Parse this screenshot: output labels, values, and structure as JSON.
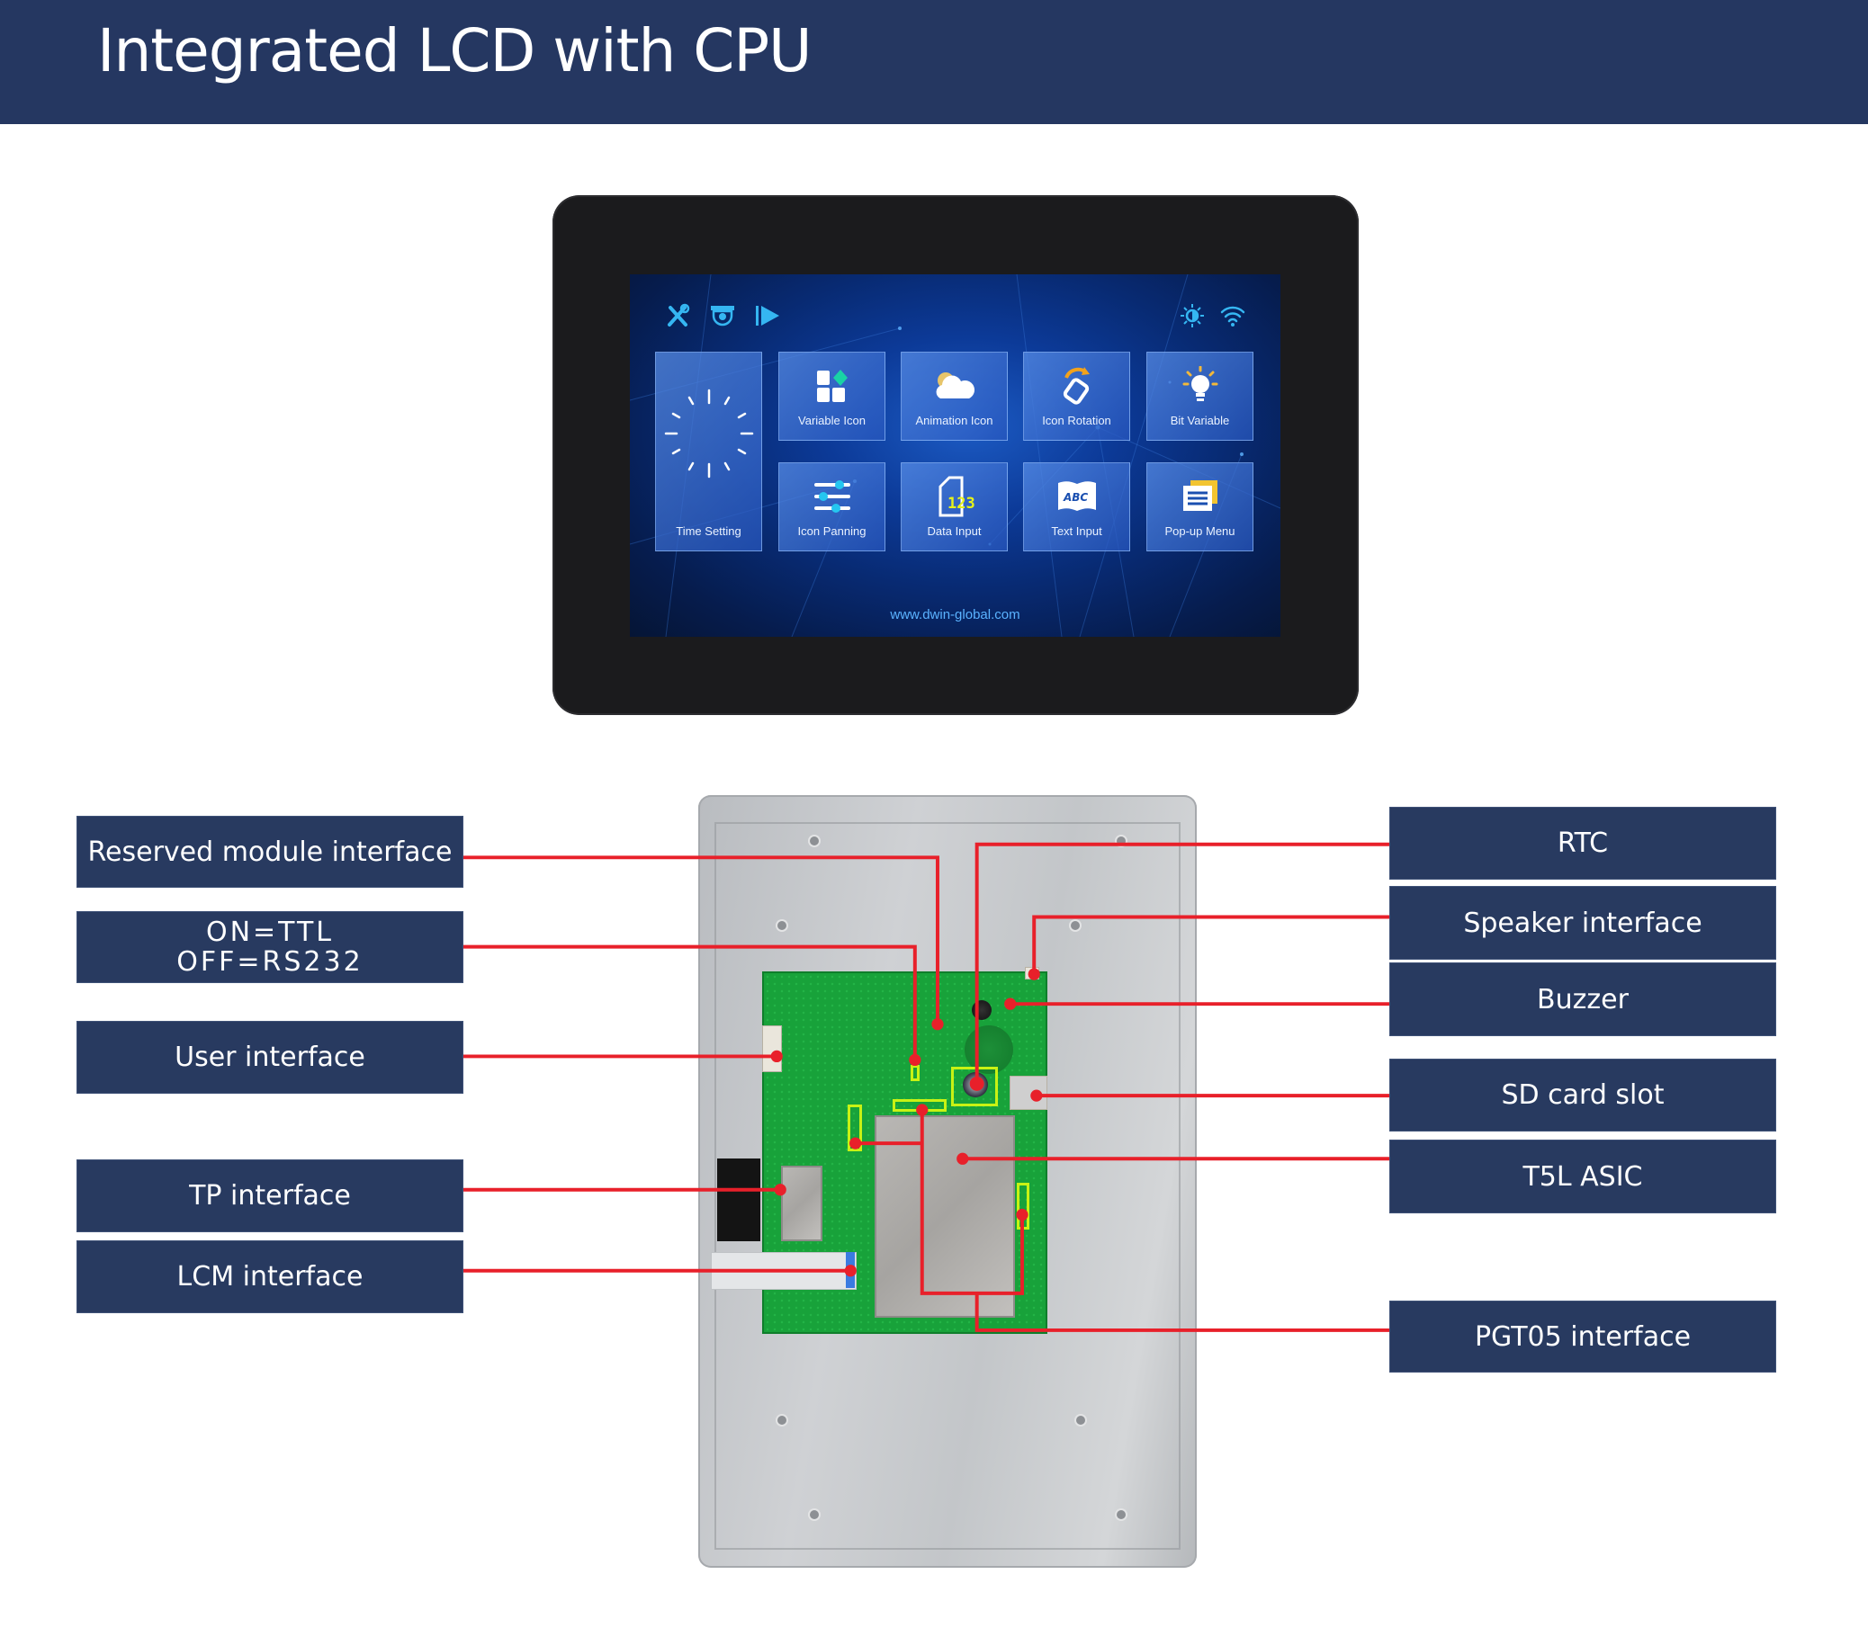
{
  "header": {
    "title": "Integrated LCD with CPU",
    "bg_color": "#253761"
  },
  "front_view": {
    "top_left_icons": [
      "tools-icon",
      "camera-icon",
      "play-icon"
    ],
    "top_right_icons": [
      "brightness-icon",
      "wifi-icon"
    ],
    "tiles": [
      {
        "label": "Time Setting",
        "icon": "clock-icon"
      },
      {
        "label": "Variable Icon",
        "icon": "blocks-icon"
      },
      {
        "label": "Animation Icon",
        "icon": "cloud-icon"
      },
      {
        "label": "Icon Rotation",
        "icon": "rotate-icon"
      },
      {
        "label": "Bit Variable",
        "icon": "bulb-icon"
      },
      {
        "label": "Icon Panning",
        "icon": "sliders-icon"
      },
      {
        "label": "Data Input",
        "icon": "number-doc-icon",
        "icon_text": "123"
      },
      {
        "label": "Text Input",
        "icon": "book-icon",
        "icon_text": "ABC"
      },
      {
        "label": "Pop-up Menu",
        "icon": "menu-icon"
      }
    ],
    "url": "www.dwin-global.com"
  },
  "callouts": {
    "left": [
      {
        "label": "Reserved module interface"
      },
      {
        "label": "ON=TTL\nOFF=RS232",
        "lines": [
          "ON=TTL",
          "OFF=RS232"
        ]
      },
      {
        "label": "User interface"
      },
      {
        "label": "TP interface"
      },
      {
        "label": "LCM interface"
      }
    ],
    "right": [
      {
        "label": "RTC"
      },
      {
        "label": "Speaker interface"
      },
      {
        "label": "Buzzer"
      },
      {
        "label": "SD card slot"
      },
      {
        "label": "T5L ASIC"
      },
      {
        "label": "PGT05 interface"
      }
    ],
    "line_color": "#e8202a",
    "box_color": "#283a60",
    "highlight_color": "#c8f214"
  }
}
